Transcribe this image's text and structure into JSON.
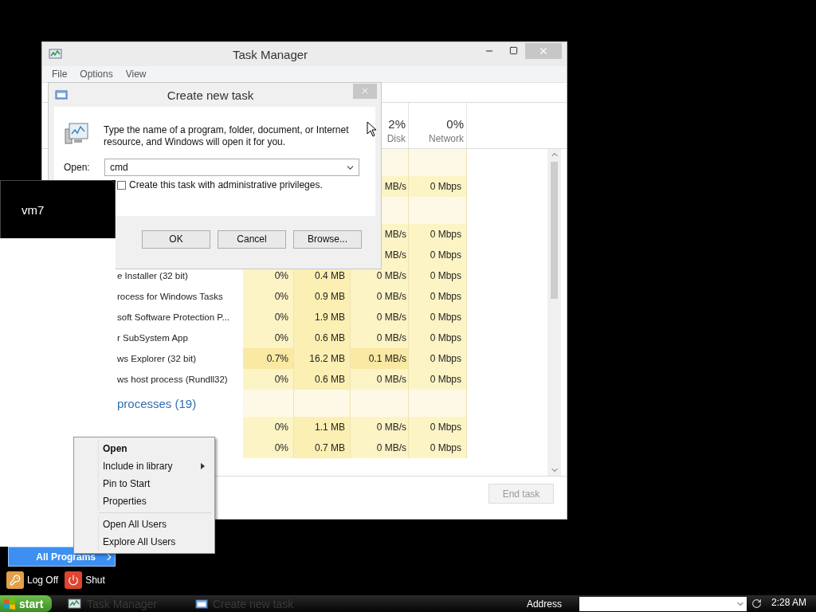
{
  "task_manager": {
    "title": "Task Manager",
    "menu": [
      "File",
      "Options",
      "View"
    ],
    "columns": [
      {
        "percent": "2%",
        "label": "Disk"
      },
      {
        "percent": "0%",
        "label": "Network"
      }
    ],
    "rows": [
      {
        "kind": "group"
      },
      {
        "kind": "process",
        "disk": "MB/s",
        "network": "0 Mbps",
        "busy": false
      },
      {
        "kind": "group"
      },
      {
        "kind": "process",
        "disk": "MB/s",
        "network": "0 Mbps",
        "busy": false
      },
      {
        "kind": "process",
        "disk": "MB/s",
        "network": "0 Mbps",
        "busy": false
      },
      {
        "kind": "process",
        "name": "e Installer (32 bit)",
        "cpu": "0%",
        "memory": "0.4 MB",
        "disk": "0 MB/s",
        "network": "0 Mbps",
        "busy": false
      },
      {
        "kind": "process",
        "name": "rocess for Windows Tasks",
        "cpu": "0%",
        "memory": "0.9 MB",
        "disk": "0 MB/s",
        "network": "0 Mbps",
        "busy": false
      },
      {
        "kind": "process",
        "name": "soft Software Protection P...",
        "cpu": "0%",
        "memory": "1.9 MB",
        "disk": "0 MB/s",
        "network": "0 Mbps",
        "busy": false
      },
      {
        "kind": "process",
        "name": "r SubSystem App",
        "cpu": "0%",
        "memory": "0.6 MB",
        "disk": "0 MB/s",
        "network": "0 Mbps",
        "busy": false
      },
      {
        "kind": "process",
        "name": "ws Explorer (32 bit)",
        "cpu": "0.7%",
        "memory": "16.2 MB",
        "disk": "0.1 MB/s",
        "network": "0 Mbps",
        "busy": true
      },
      {
        "kind": "process",
        "name": "ws host process (Rundll32)",
        "cpu": "0%",
        "memory": "0.6 MB",
        "disk": "0 MB/s",
        "network": "0 Mbps",
        "busy": false
      },
      {
        "kind": "group",
        "name": "processes (19)"
      },
      {
        "kind": "process",
        "cpu": "0%",
        "memory": "1.1 MB",
        "disk": "0 MB/s",
        "network": "0 Mbps",
        "busy": false
      },
      {
        "kind": "process",
        "cpu": "0%",
        "memory": "0.7 MB",
        "disk": "0 MB/s",
        "network": "0 Mbps",
        "busy": false
      }
    ],
    "end_task": {
      "label": "End task",
      "disabled": true
    }
  },
  "dialog": {
    "title": "Create new task",
    "message": "Type the name of a program, folder, document, or Internet resource, and Windows will open it for you.",
    "open_label": "Open:",
    "value": "cmd",
    "checkbox": {
      "label": "Create this task with administrative privileges.",
      "checked": false
    },
    "buttons": [
      "OK",
      "Cancel",
      "Browse..."
    ]
  },
  "start_menu": {
    "user": "vm7",
    "all_programs": "All Programs",
    "buttons": [
      {
        "kind": "logoff",
        "label": "Log Off"
      },
      {
        "kind": "shutdown",
        "label": "Shut"
      }
    ]
  },
  "context_menu": {
    "items": [
      {
        "kind": "item",
        "label": "Open",
        "default": true,
        "submenu": false
      },
      {
        "kind": "item",
        "label": "Include in library",
        "default": false,
        "submenu": true
      },
      {
        "kind": "item",
        "label": "Pin to Start",
        "default": false,
        "submenu": false
      },
      {
        "kind": "item",
        "label": "Properties",
        "default": false,
        "submenu": false
      },
      {
        "kind": "separator"
      },
      {
        "kind": "item",
        "label": "Open All Users",
        "default": false,
        "submenu": false
      },
      {
        "kind": "item",
        "label": "Explore All Users",
        "default": false,
        "submenu": false
      }
    ]
  },
  "taskbar": {
    "start": "start",
    "tasks": [
      {
        "kind": "taskmgr",
        "label": "Task Manager"
      },
      {
        "kind": "run",
        "label": "Create new task"
      }
    ],
    "address_label": "Address",
    "clock": "2:28 AM"
  }
}
